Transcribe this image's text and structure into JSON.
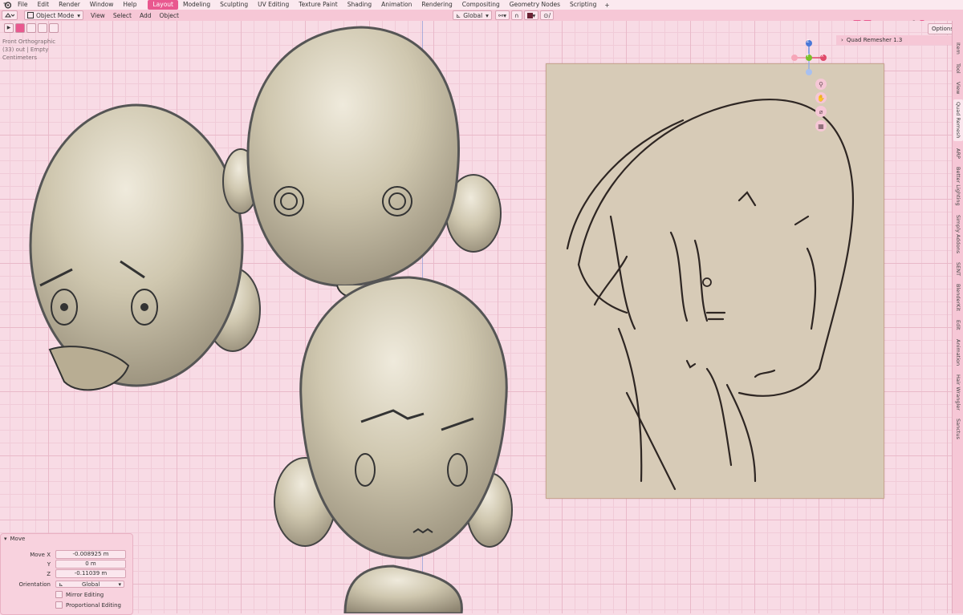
{
  "menubar": {
    "items": [
      "File",
      "Edit",
      "Render",
      "Window",
      "Help"
    ],
    "workspaces": [
      "Layout",
      "Modeling",
      "Sculpting",
      "UV Editing",
      "Texture Paint",
      "Shading",
      "Animation",
      "Rendering",
      "Compositing",
      "Geometry Nodes",
      "Scripting"
    ],
    "active_workspace": "Layout",
    "plus": "+"
  },
  "header": {
    "mode": "Object Mode",
    "menus": [
      "View",
      "Select",
      "Add",
      "Object"
    ],
    "transform_orientation": "Global",
    "options": "Options"
  },
  "viewport": {
    "view_name": "Front Orthographic",
    "collection_info": "(33) out | Empty",
    "units": "Centimeters"
  },
  "gizmo": {
    "z": "Z",
    "y": "Y",
    "x": "X"
  },
  "npanel": {
    "addon_header": "Quad Remesher 1.3",
    "tabs": [
      "Item",
      "Tool",
      "View",
      "Quad Remesh",
      "ARP",
      "Better Lighting",
      "Simply Addons",
      "SENT",
      "BlenderKit",
      "Edit",
      "Animation",
      "Hair Wrangler",
      "Sanctus"
    ],
    "active_tab": "Quad Remesh"
  },
  "move_panel": {
    "title": "Move",
    "move_x_label": "Move X",
    "move_x": "-0.008925 m",
    "y_label": "Y",
    "y": "0 m",
    "z_label": "Z",
    "z": "-0.11039 m",
    "orientation_label": "Orientation",
    "orientation": "Global",
    "mirror_editing": "Mirror Editing",
    "proportional_editing": "Proportional Editing"
  },
  "colors": {
    "accent": "#e9588f",
    "grid_bg": "#f8dbe5",
    "clay": "#c6bea6"
  }
}
